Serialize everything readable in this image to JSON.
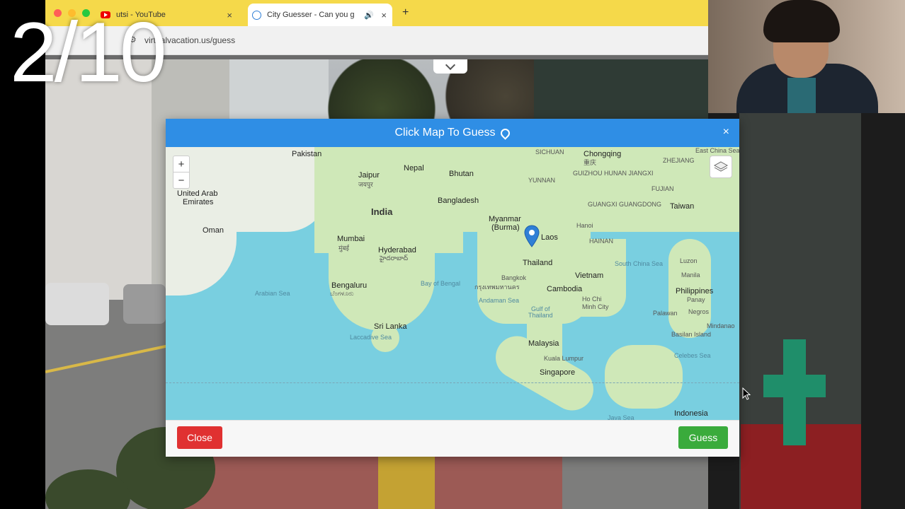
{
  "browser": {
    "tabs": [
      {
        "title": "utsi - YouTube",
        "icon": "youtube-icon"
      },
      {
        "title": "City Guesser - Can you g",
        "icon": "globe-icon"
      }
    ],
    "new_tab_label": "+",
    "url": "virtualvacation.us/guess"
  },
  "counter": "2/10",
  "modal": {
    "title": "Click Map To Guess",
    "close_glyph": "×",
    "zoom_in": "+",
    "zoom_out": "−",
    "close_button": "Close",
    "guess_button": "Guess"
  },
  "map_labels": {
    "pakistan": "Pakistan",
    "sichuan": "SICHUAN",
    "chongqing": "Chongqing",
    "chongqing_cn": "重庆",
    "zhejiang": "ZHEJIANG",
    "nepal": "Nepal",
    "bhutan": "Bhutan",
    "guizhou": "GUIZHOU  HUNAN  JIANGXI",
    "jaipur": "Jaipur",
    "jaipur_hi": "जयपुर",
    "uae": "United Arab",
    "uae2": "Emirates",
    "yunnan": "YUNNAN",
    "fujian": "FUJIAN",
    "india": "India",
    "bangladesh": "Bangladesh",
    "guangxi": "GUANGXI  GUANGDONG",
    "taiwan": "Taiwan",
    "oman": "Oman",
    "myanmar": "Myanmar",
    "burma": "(Burma)",
    "hanoi": "Hanoi",
    "mumbai": "Mumbai",
    "mumbai_mr": "मुंबई",
    "laos": "Laos",
    "hainan": "HAINAN",
    "hyderabad": "Hyderabad",
    "hyderabad_te": "హైదరాబాద్",
    "thailand": "Thailand",
    "south_china_sea": "South China Sea",
    "luzon": "Luzon",
    "manila": "Manila",
    "vietnam": "Vietnam",
    "arabian_sea": "Arabian Sea",
    "bay_of_bengal": "Bay of Bengal",
    "bangkok": "Bangkok",
    "bangkok_th": "กรุงเทพมหานคร",
    "bengaluru": "Bengaluru",
    "bengaluru_kn": "ಬೆಂಗಳೂರು",
    "cambodia": "Cambodia",
    "philippines": "Philippines",
    "andaman": "Andaman Sea",
    "hcmc": "Ho Chi",
    "hcmc2": "Minh City",
    "panay": "Panay",
    "gulf_thailand": "Gulf of",
    "gulf_thailand2": "Thailand",
    "negros": "Negros",
    "palawan": "Palawan",
    "sri_lanka": "Sri Lanka",
    "laccadive": "Laccadive Sea",
    "mindanao": "Mindanao",
    "basilan": "Basilan Island",
    "malaysia": "Malaysia",
    "kuala_lumpur": "Kuala Lumpur",
    "celebes": "Celebes Sea",
    "singapore": "Singapore",
    "indonesia": "Indonesia",
    "java_sea": "Java Sea",
    "east_china_sea": "East China Sea"
  },
  "colors": {
    "tabbar": "#f5d94a",
    "modal_header": "#2f8ee5",
    "map_water": "#79cfe0",
    "map_land": "#cfe8b8",
    "close_button": "#e03131",
    "guess_button": "#3aab3c",
    "pin": "#2f7fd6"
  }
}
